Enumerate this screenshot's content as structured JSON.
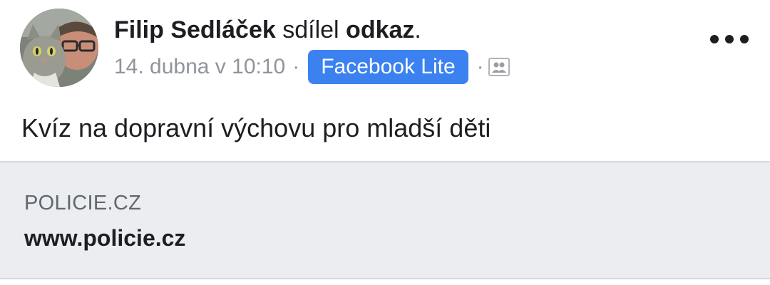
{
  "post": {
    "author": "Filip Sedláček",
    "action_verb": "sdílel",
    "action_object": "odkaz",
    "action_suffix": ".",
    "timestamp": "14. dubna v 10:10",
    "separator": "·",
    "app_badge": "Facebook Lite",
    "audience_icon": "friends-icon",
    "more_icon": "more-dots-icon",
    "message": "Kvíz na dopravní výchovu pro mladší děti"
  },
  "link_preview": {
    "domain": "POLICIE.CZ",
    "title": "www.policie.cz"
  },
  "colors": {
    "badge_bg": "#3b82f0",
    "meta_text": "#90949c",
    "preview_bg": "#ebedf0",
    "primary_text": "#1c1e21"
  }
}
